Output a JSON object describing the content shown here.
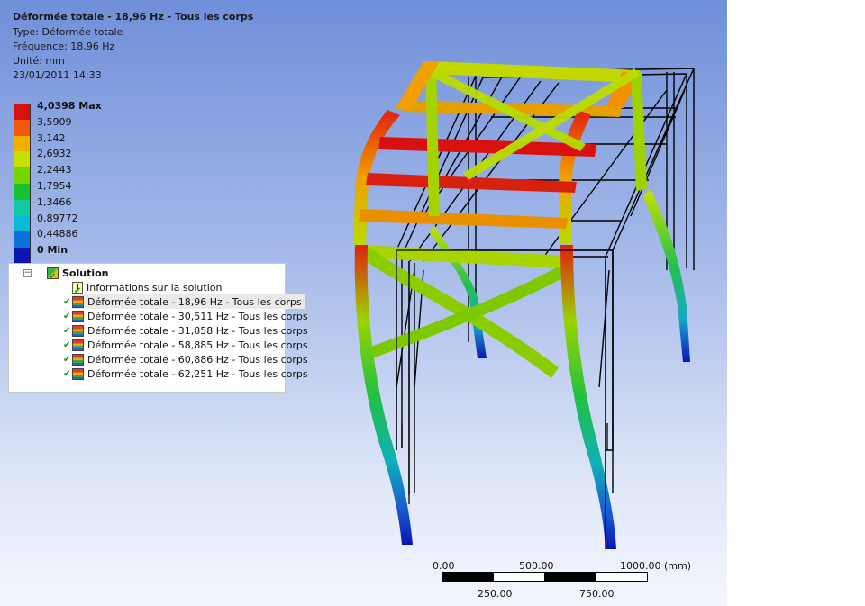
{
  "result": {
    "title": "Déformée totale - 18,96 Hz - Tous les corps",
    "type": "Type: Déformée totale",
    "frequency": "Fréquence: 18,96 Hz",
    "unit": "Unité: mm",
    "date": "23/01/2011 14:33"
  },
  "legend": {
    "items": [
      {
        "label": "4,0398 Max",
        "color": "#d8110f",
        "bold": true
      },
      {
        "label": "3,5909",
        "color": "#ef5a0a",
        "bold": false
      },
      {
        "label": "3,142",
        "color": "#f1ad00",
        "bold": false
      },
      {
        "label": "2,6932",
        "color": "#c4e100",
        "bold": false
      },
      {
        "label": "2,2443",
        "color": "#78d400",
        "bold": false
      },
      {
        "label": "1,7954",
        "color": "#18c032",
        "bold": false
      },
      {
        "label": "1,3466",
        "color": "#12c9a2",
        "bold": false
      },
      {
        "label": "0,89772",
        "color": "#0ab8d8",
        "bold": false
      },
      {
        "label": "0,44886",
        "color": "#0a72d8",
        "bold": false
      },
      {
        "label": "0 Min",
        "color": "#0a16b4",
        "bold": true
      }
    ]
  },
  "tree": {
    "solution_label": "Solution",
    "info_label": "Informations sur la solution",
    "results": [
      "Déformée totale - 18,96 Hz - Tous les corps",
      "Déformée totale - 30,511 Hz - Tous les corps",
      "Déformée totale - 31,858 Hz - Tous les corps",
      "Déformée totale - 58,885 Hz - Tous les corps",
      "Déformée totale - 60,886 Hz - Tous les corps",
      "Déformée totale - 62,251 Hz - Tous les corps"
    ]
  },
  "scale": {
    "top_labels": [
      "0.00",
      "500.00",
      "1000.00 (mm)"
    ],
    "bottom_labels": [
      "250.00",
      "750.00"
    ]
  }
}
